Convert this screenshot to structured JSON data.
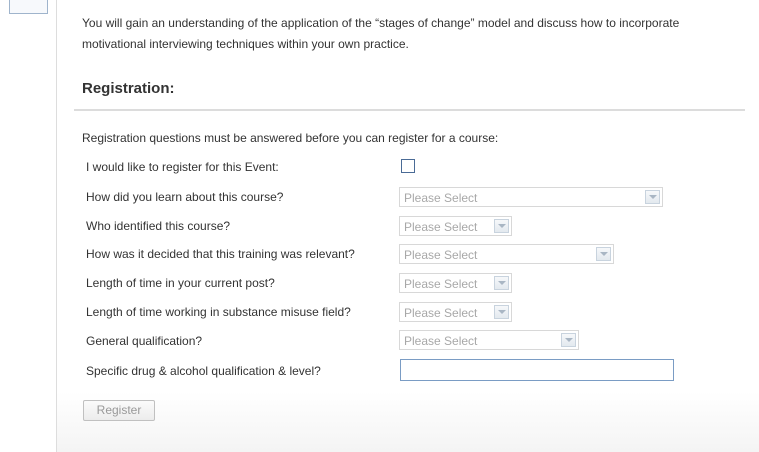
{
  "intro": {
    "text": "You will gain an understanding of the application of the “stages of change” model and discuss how to incorporate motivational interviewing techniques within your own practice."
  },
  "registration": {
    "heading": "Registration:",
    "instruction": "Registration questions must be answered before you can register for a course:",
    "questions": [
      {
        "label": "I would like to register for this Event:",
        "type": "checkbox",
        "checked": false
      },
      {
        "label": "How did you learn about this course?",
        "type": "select",
        "value": "Please Select"
      },
      {
        "label": "Who identified this course?",
        "type": "select",
        "value": "Please Select"
      },
      {
        "label": "How was it decided that this training was relevant?",
        "type": "select",
        "value": "Please Select"
      },
      {
        "label": "Length of time in your current post?",
        "type": "select",
        "value": "Please Select"
      },
      {
        "label": "Length of time working in substance misuse field?",
        "type": "select",
        "value": "Please Select"
      },
      {
        "label": "General qualification?",
        "type": "select",
        "value": "Please Select"
      },
      {
        "label": "Specific drug & alcohol qualification & level?",
        "type": "text",
        "value": ""
      }
    ],
    "register_button": "Register"
  },
  "colors": {
    "text": "#333333",
    "placeholder": "#a8a8a8",
    "checkbox_border": "#4a6b96",
    "input_border": "#7a9cc4",
    "disabled_button_text": "#999999"
  },
  "icons": {
    "select_arrow": "chevron-down-icon"
  }
}
